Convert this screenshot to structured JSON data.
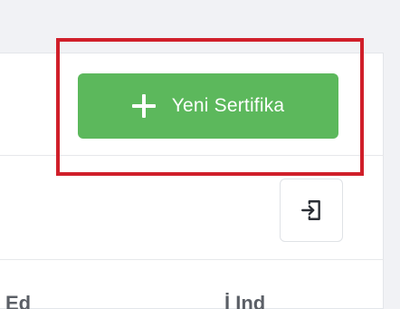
{
  "toolbar": {
    "new_certificate_label": "Yeni Sertifika",
    "plus_icon": "plus-icon",
    "import_icon": "login-icon"
  },
  "table": {
    "headers_partial": [
      "Ed",
      "İ  Ind"
    ]
  },
  "colors": {
    "primary_button": "#5cb85c",
    "highlight": "#d01f2a",
    "background": "#f1f2f5"
  }
}
